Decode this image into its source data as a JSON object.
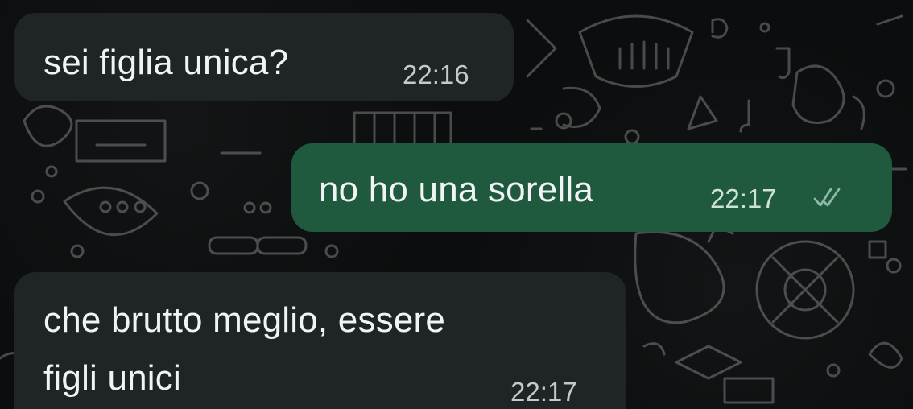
{
  "messages": [
    {
      "direction": "incoming",
      "text": "sei figlia unica?",
      "time": "22:16"
    },
    {
      "direction": "outgoing",
      "text": "no ho una sorella",
      "time": "22:17",
      "status_icon": "double-check-icon",
      "status_color": "#8fb7a5"
    },
    {
      "direction": "incoming",
      "text_lines": [
        "che brutto meglio, essere",
        "figli unici"
      ],
      "time": "22:17"
    }
  ],
  "colors": {
    "incoming_bubble": "#1f2427",
    "outgoing_bubble": "#1f5a3f",
    "background": "#0b0d0e",
    "text": "#f1f3f4"
  }
}
